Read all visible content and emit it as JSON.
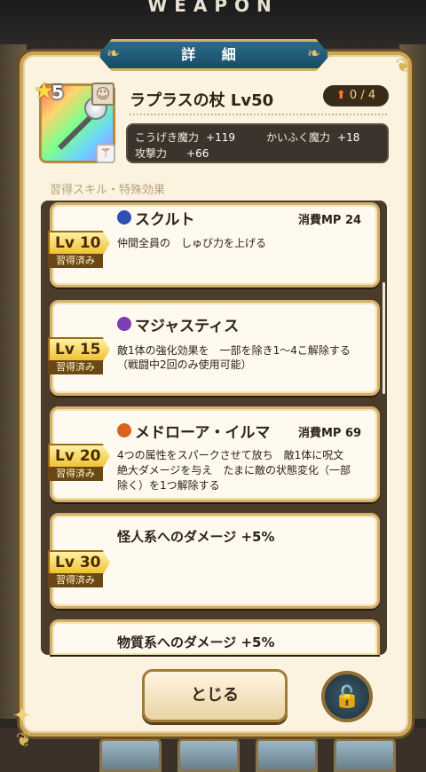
{
  "window": {
    "title": "WEAPON"
  },
  "dialog": {
    "title": "詳 細"
  },
  "item": {
    "rarity": "5",
    "name": "ラプラスの杖 Lv50",
    "upgrade": "0 / 4",
    "stats": [
      {
        "label": "こうげき魔力",
        "value": "+119"
      },
      {
        "label": "かいふく魔力",
        "value": "+18"
      },
      {
        "label": "攻撃力",
        "value": "+66"
      }
    ]
  },
  "section_label": "習得スキル・特殊効果",
  "skills": [
    {
      "level": "Lv 10",
      "status": "習得済み",
      "name": "スクルト",
      "mp": "消費MP 24",
      "desc1": "仲間全員の　しゅび力を上げる",
      "desc2": "",
      "desc3": "",
      "icon_color": "#2f4fb5"
    },
    {
      "level": "Lv 15",
      "status": "習得済み",
      "name": "マジャスティス",
      "mp": "",
      "desc1": "敵1体の強化効果を　一部を除き1～4こ解除する",
      "desc2": "（戦闘中2回のみ使用可能）",
      "desc3": "",
      "icon_color": "#7a3fb0"
    },
    {
      "level": "Lv 20",
      "status": "習得済み",
      "name": "メドローア・イルマ",
      "mp": "消費MP 69",
      "desc1": "4つの属性をスパークさせて放ち　敵1体に呪文",
      "desc2": "絶大ダメージを与え　たまに敵の状態変化（一部",
      "desc3": "除く）を1つ解除する",
      "icon_color": "#d9631f"
    },
    {
      "level": "Lv 30",
      "status": "習得済み",
      "name": "怪人系へのダメージ +5%",
      "mp": "",
      "desc1": "",
      "desc2": "",
      "desc3": "",
      "icon_color": ""
    },
    {
      "level": "",
      "status": "",
      "name": "物質系へのダメージ +5%",
      "mp": "",
      "desc1": "",
      "desc2": "",
      "desc3": "",
      "icon_color": ""
    }
  ],
  "buttons": {
    "close": "とじる"
  },
  "icons": {
    "star": "star-icon",
    "upgrade": "arrow-up-icon",
    "lock": "unlock-icon"
  },
  "colors": {
    "panel_bg": "#fbf3df",
    "banner": "#1a4c66",
    "gold": "#c9a55a"
  }
}
